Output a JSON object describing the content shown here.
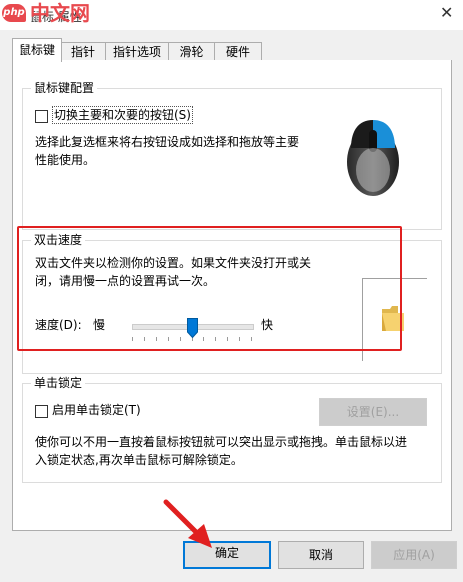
{
  "window": {
    "title": "鼠标 属性",
    "close_glyph": "✕",
    "watermark_php": "php",
    "watermark_cn": "中文网"
  },
  "tabs": [
    {
      "label": "鼠标键",
      "active": true
    },
    {
      "label": "指针",
      "active": false
    },
    {
      "label": "指针选项",
      "active": false
    },
    {
      "label": "滑轮",
      "active": false
    },
    {
      "label": "硬件",
      "active": false
    }
  ],
  "button_config": {
    "legend": "鼠标键配置",
    "checkbox_label": "切换主要和次要的按钮(S)",
    "checked": false,
    "description_line1": "选择此复选框来将右按钮设成如选择和拖放等主要",
    "description_line2": "性能使用。"
  },
  "double_click": {
    "legend": "双击速度",
    "description_line1": "双击文件夹以检测你的设置。如果文件夹没打开或关",
    "description_line2": "闭，请用慢一点的设置再试一次。",
    "speed_label": "速度(D):",
    "slow_label": "慢",
    "fast_label": "快",
    "slider_level": 0.5,
    "folder_icon": "folder-icon"
  },
  "click_lock": {
    "legend": "单击锁定",
    "checkbox_label": "启用单击锁定(T)",
    "checked": false,
    "settings_button": "设置(E)...",
    "description_line1": "使你可以不用一直按着鼠标按钮就可以突出显示或拖拽。单击鼠标以进",
    "description_line2": "入锁定状态,再次单击鼠标可解除锁定。"
  },
  "footer": {
    "ok": "确定",
    "cancel": "取消",
    "apply": "应用(A)"
  },
  "colors": {
    "accent": "#0078d7",
    "annotation_red": "#e02020"
  }
}
